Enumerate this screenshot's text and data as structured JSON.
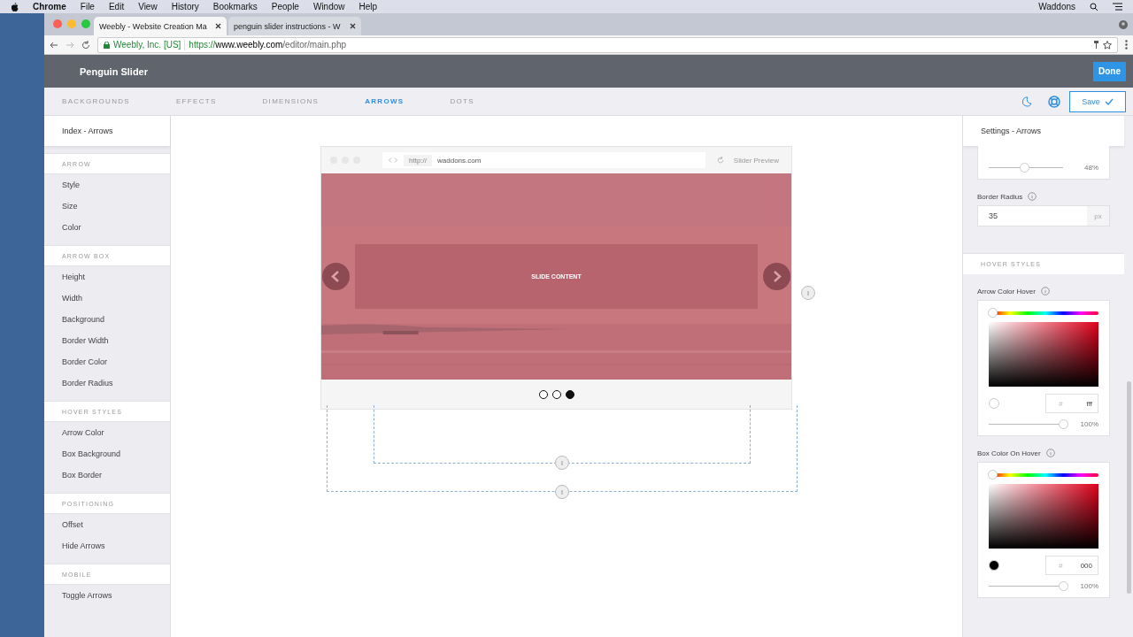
{
  "menubar": {
    "app": "Chrome",
    "items": [
      "File",
      "Edit",
      "View",
      "History",
      "Bookmarks",
      "People",
      "Window",
      "Help"
    ],
    "user": "Waddons"
  },
  "browser": {
    "tabs": [
      {
        "title": "Weebly - Website Creation Ma",
        "selected": true
      },
      {
        "title": "penguin slider instructions - W",
        "selected": false
      }
    ],
    "address": {
      "owner": "Weebly, Inc. [US]",
      "scheme": "https://",
      "host": "www.weebly.com",
      "path": "/editor/main.php"
    }
  },
  "header": {
    "title": "Penguin Slider",
    "done": "Done"
  },
  "nav": {
    "tabs": [
      {
        "label": "BACKGROUNDS",
        "selected": false
      },
      {
        "label": "EFFECTS",
        "selected": false
      },
      {
        "label": "DIMENSIONS",
        "selected": false
      },
      {
        "label": "ARROWS",
        "selected": true
      },
      {
        "label": "DOTS",
        "selected": false
      }
    ],
    "save": "Save"
  },
  "sidebar": {
    "heading": "Index - Arrows",
    "sections": [
      {
        "title": "ARROW",
        "items": [
          "Style",
          "Size",
          "Color"
        ]
      },
      {
        "title": "ARROW BOX",
        "items": [
          "Height",
          "Width",
          "Background",
          "Border Width",
          "Border Color",
          "Border Radius"
        ]
      },
      {
        "title": "HOVER STYLES",
        "items": [
          "Arrow Color",
          "Box Background",
          "Box Border"
        ]
      },
      {
        "title": "POSITIONING",
        "items": [
          "Offset",
          "Hide Arrows"
        ]
      },
      {
        "title": "MOBILE",
        "items": [
          "Toggle Arrows"
        ]
      }
    ]
  },
  "preview": {
    "protocol": "http://",
    "url": "waddons.com",
    "label": "Slider Preview",
    "slide_text": "SLIDE CONTENT",
    "dots": [
      {
        "selected": false
      },
      {
        "selected": false
      },
      {
        "selected": true
      }
    ]
  },
  "settings": {
    "heading": "Settings - Arrows",
    "top_slider": {
      "level": 0.48,
      "reading": "48%"
    },
    "border_radius": {
      "label": "Border Radius",
      "value": "35",
      "unit": "px"
    },
    "section": "HOVER STYLES",
    "pickers": [
      {
        "label": "Arrow Color Hover",
        "hue": {
          "level": 0
        },
        "hash": "#",
        "hex": "fff",
        "color": "#ffffff",
        "alpha": {
          "level": 1,
          "reading": "100%"
        }
      },
      {
        "label": "Box Color On Hover",
        "hue": {
          "level": 0
        },
        "hash": "#",
        "hex": "000",
        "color": "#000000",
        "alpha": {
          "level": 1,
          "reading": "100%"
        }
      }
    ]
  }
}
